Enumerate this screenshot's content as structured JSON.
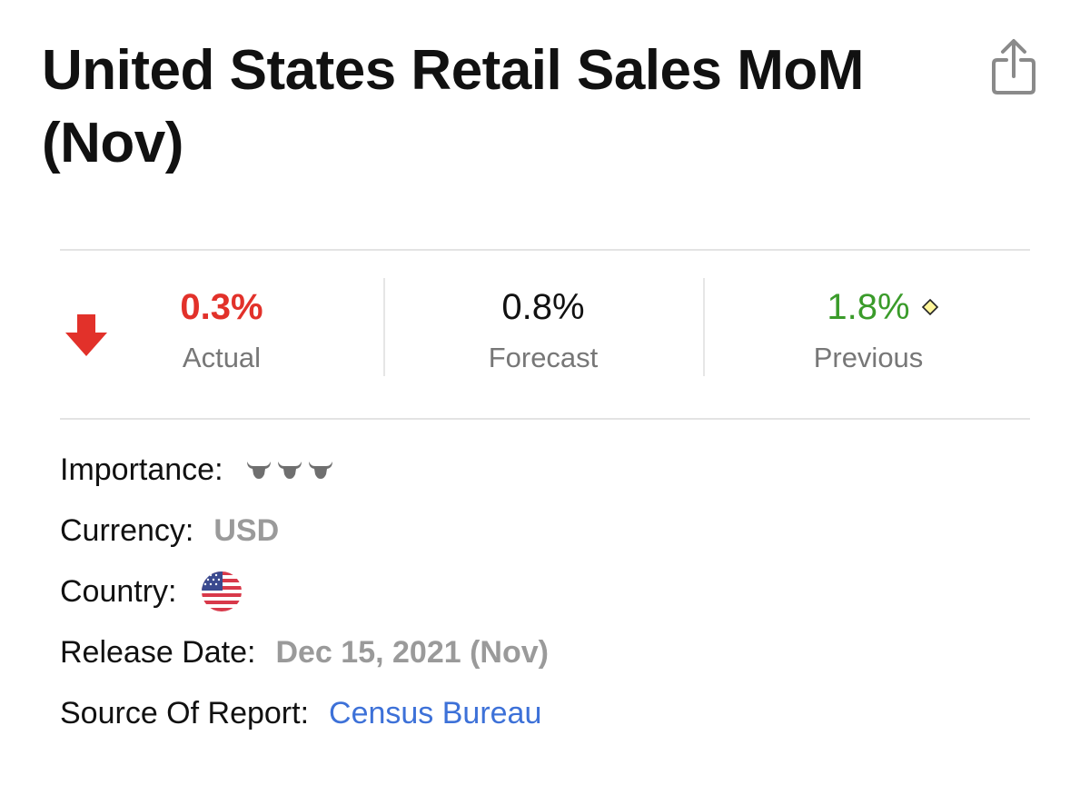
{
  "header": {
    "title": "United States Retail Sales MoM (Nov)"
  },
  "icons": {
    "share": "share-icon",
    "trend": "down-arrow-icon",
    "revised": "revised-diamond-icon",
    "importance": "bull-icon",
    "country": "us-flag-icon"
  },
  "colors": {
    "actual_negative": "#e2312a",
    "previous_positive": "#3a9b2a",
    "link": "#3d71d8",
    "muted": "#9a9a9a"
  },
  "stats": {
    "actual": {
      "value": "0.3%",
      "label": "Actual"
    },
    "forecast": {
      "value": "0.8%",
      "label": "Forecast"
    },
    "previous": {
      "value": "1.8%",
      "label": "Previous"
    }
  },
  "details": {
    "importance": {
      "label": "Importance:",
      "level": 3,
      "max": 3
    },
    "currency": {
      "label": "Currency:",
      "value": "USD"
    },
    "country": {
      "label": "Country:"
    },
    "release_date": {
      "label": "Release Date:",
      "value": "Dec 15, 2021 (Nov)"
    },
    "source": {
      "label": "Source Of Report:",
      "value": "Census Bureau"
    }
  }
}
